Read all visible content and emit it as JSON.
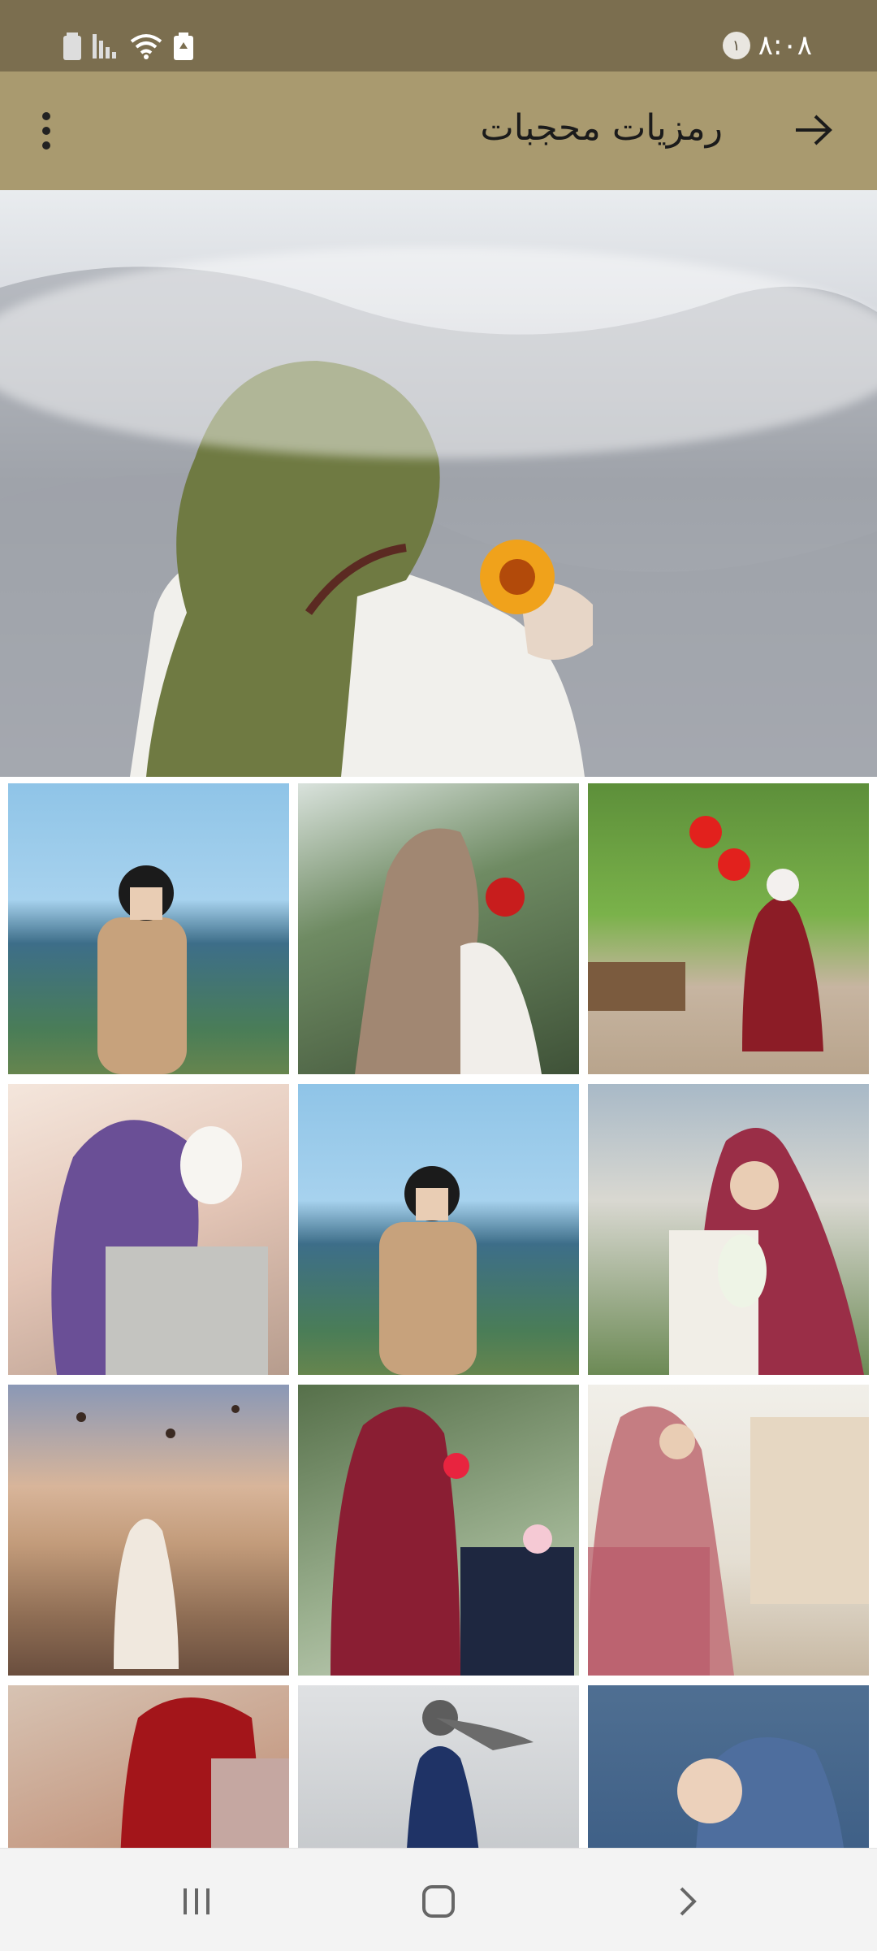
{
  "status_bar": {
    "time": "٨:٠٨",
    "notification_count": "١",
    "icons": [
      "battery-icon",
      "signal-icon",
      "wifi-icon",
      "battery-saver-icon"
    ]
  },
  "app_bar": {
    "title": "رمزيات محجبات",
    "back_icon": "arrow-right-icon",
    "menu_icon": "more-vertical-icon"
  },
  "hero": {
    "image": "woman-olive-hijab-sunflower"
  },
  "grid": {
    "tiles": [
      {
        "image": "woman-black-striped-hijab-bridge"
      },
      {
        "image": "woman-taupe-hijab-red-flower"
      },
      {
        "image": "woman-red-dress-balloons-park"
      },
      {
        "image": "woman-purple-hijab-white-rose"
      },
      {
        "image": "woman-black-striped-hijab-sea"
      },
      {
        "image": "woman-maroon-hijab-bouquet"
      },
      {
        "image": "woman-white-dress-balloons-city"
      },
      {
        "image": "woman-burgundy-hijab-rose"
      },
      {
        "image": "woman-floral-hijab-building"
      },
      {
        "image": "woman-red-hijab-plaid"
      },
      {
        "image": "woman-blue-dress-waterfront"
      },
      {
        "image": "woman-blue-hijab-smiling"
      }
    ]
  },
  "nav_bar": {
    "icons": [
      "recent-apps-icon",
      "home-icon",
      "back-icon"
    ]
  },
  "colors": {
    "status_bar": "#7b6e4f",
    "app_bar": "#a99a6f",
    "nav_bar": "#f3f3f3"
  }
}
